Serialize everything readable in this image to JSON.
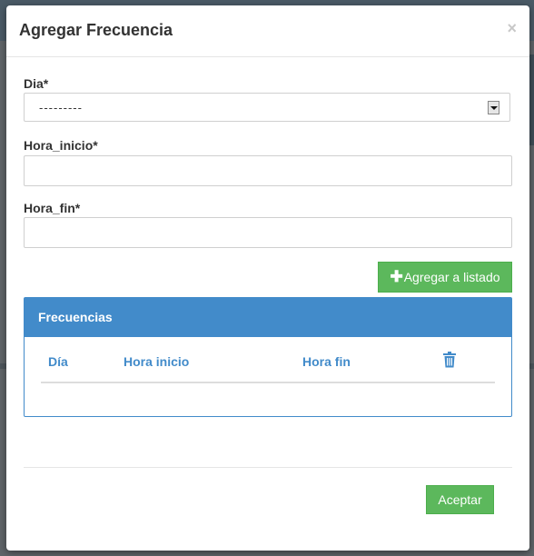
{
  "modal": {
    "title": "Agregar Frecuencia",
    "close_symbol": "×"
  },
  "form": {
    "dia_label": "Dia*",
    "dia_selected": "---------",
    "hora_inicio_label": "Hora_inicio*",
    "hora_inicio_value": "",
    "hora_fin_label": "Hora_fin*",
    "hora_fin_value": "",
    "add_button_label": "Agregar a listado"
  },
  "panel": {
    "heading": "Frecuencias",
    "columns": [
      "Día",
      "Hora inicio",
      "Hora fin"
    ],
    "rows": []
  },
  "footer": {
    "accept_label": "Aceptar"
  },
  "icons": {
    "plus": "plus-icon",
    "trash": "trash-icon",
    "dropdown": "chevron-down-icon"
  },
  "colors": {
    "primary": "#428bca",
    "success": "#5cb85c"
  }
}
